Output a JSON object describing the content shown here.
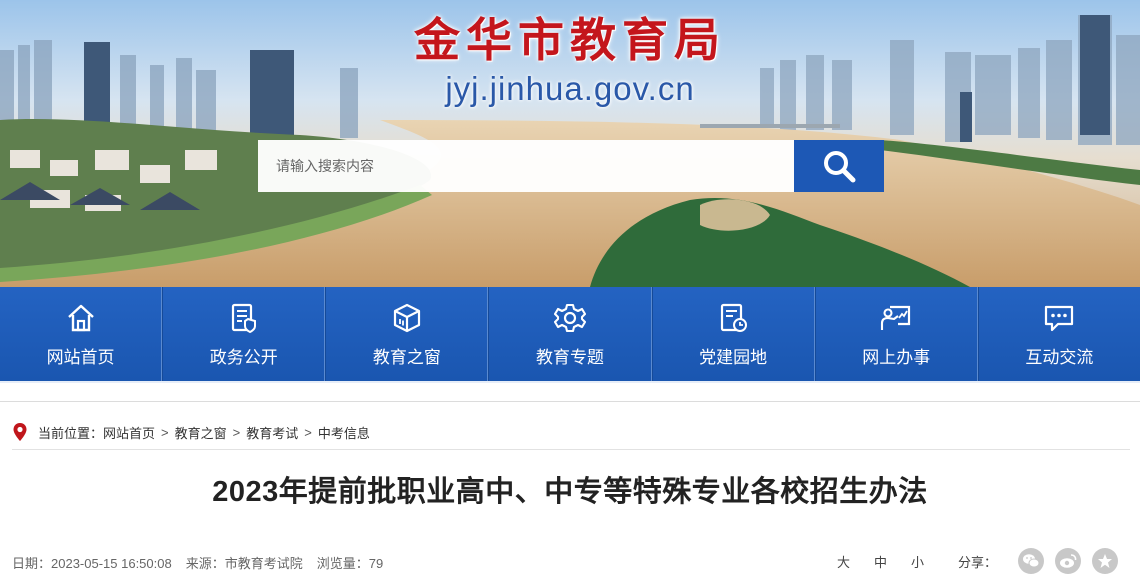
{
  "header": {
    "site_title": "金华市教育局",
    "site_domain": "jyj.jinhua.gov.cn"
  },
  "search": {
    "placeholder": "请输入搜索内容",
    "button_icon": "search-icon"
  },
  "nav": {
    "items": [
      {
        "label": "网站首页",
        "icon": "home-icon"
      },
      {
        "label": "政务公开",
        "icon": "document-shield-icon"
      },
      {
        "label": "教育之窗",
        "icon": "box-icon"
      },
      {
        "label": "教育专题",
        "icon": "gear-icon"
      },
      {
        "label": "党建园地",
        "icon": "document-clock-icon"
      },
      {
        "label": "网上办事",
        "icon": "presentation-icon"
      },
      {
        "label": "互动交流",
        "icon": "chat-icon"
      }
    ]
  },
  "breadcrumb": {
    "prefix": "当前位置：",
    "items": [
      "网站首页",
      "教育之窗",
      "教育考试",
      "中考信息"
    ],
    "separator": ">"
  },
  "article": {
    "title": "2023年提前批职业高中、中专等特殊专业各校招生办法",
    "date": "日期：2023-05-15 16:50:08",
    "source": "来源：市教育考试院",
    "views": "浏览量：79"
  },
  "tools": {
    "size_large": "大",
    "size_medium": "中",
    "size_small": "小",
    "share_label": "分享：",
    "share_icons": [
      "wechat-icon",
      "weibo-icon",
      "favorite-icon"
    ]
  },
  "colors": {
    "title_red": "#c4161c",
    "domain_blue": "#2a58a8",
    "nav_blue": "#1c5ab7",
    "location_pin": "#c0161c"
  }
}
